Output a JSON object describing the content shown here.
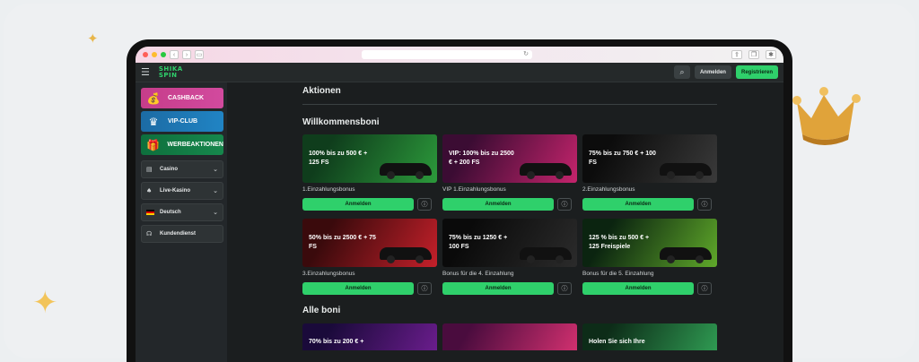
{
  "browser": {
    "reload_icon": "reload-icon"
  },
  "site": {
    "logo_line1": "SHIKA",
    "logo_line2": "SPIN",
    "login_label": "Anmelden",
    "register_label": "Registrieren"
  },
  "sidebar": {
    "promos": [
      {
        "label": "CASHBACK",
        "icon": "cashback-bag-icon"
      },
      {
        "label": "VIP-CLUB",
        "icon": "crown-icon"
      },
      {
        "label": "WERBEAKTIONEN",
        "icon": "gift-icon"
      }
    ],
    "items": [
      {
        "label": "Casino",
        "icon": "cards-icon"
      },
      {
        "label": "Live-Kasino",
        "icon": "spade-icon"
      },
      {
        "label": "Deutsch",
        "icon": "flag-de-icon"
      },
      {
        "label": "Kundendienst",
        "icon": "headset-icon"
      }
    ]
  },
  "main": {
    "title": "Aktionen",
    "welcome_title": "Willkommensboni",
    "cards": [
      {
        "banner": "100% bis zu 500 € + 125 FS",
        "label": "1.Einzahlungsbonus",
        "button": "Anmelden",
        "colors": [
          "#0f3d1c",
          "#2c9a3b"
        ]
      },
      {
        "banner": "VIP: 100% bis zu 2500 € + 200 FS",
        "label": "VIP 1.Einzahlungsbonus",
        "button": "Anmelden",
        "colors": [
          "#3b0c33",
          "#c4246c"
        ]
      },
      {
        "banner": "75% bis zu 750 € + 100 FS",
        "label": "2.Einzahlungsbonus",
        "button": "Anmelden",
        "colors": [
          "#0c0c0c",
          "#3a3a3a"
        ]
      },
      {
        "banner": "50% bis zu 2500 € + 75 FS",
        "label": "3.Einzahlungsbonus",
        "button": "Anmelden",
        "colors": [
          "#3a0a0c",
          "#c4202a"
        ]
      },
      {
        "banner": "75% bis zu 1250 € + 100 FS",
        "label": "Bonus für die 4. Einzahlung",
        "button": "Anmelden",
        "colors": [
          "#0a0a0a",
          "#2b2b2b"
        ]
      },
      {
        "banner": "125 % bis zu 500 € + 125 Freispiele",
        "label": "Bonus für die 5. Einzahlung",
        "button": "Anmelden",
        "colors": [
          "#0b2410",
          "#5fa82a"
        ]
      }
    ],
    "all_title": "Alle boni",
    "teasers": [
      {
        "text": "70% bis zu 200 € +",
        "colors": [
          "#1a0a3a",
          "#6a1d8c"
        ]
      },
      {
        "text": "",
        "colors": [
          "#4a0c3e",
          "#d1306f"
        ]
      },
      {
        "text": "Holen Sie sich Ihre",
        "colors": [
          "#0d2c18",
          "#2f9a52"
        ]
      }
    ]
  },
  "colors": {
    "accent": "#2fd06b",
    "background": "#1b1e1f"
  }
}
